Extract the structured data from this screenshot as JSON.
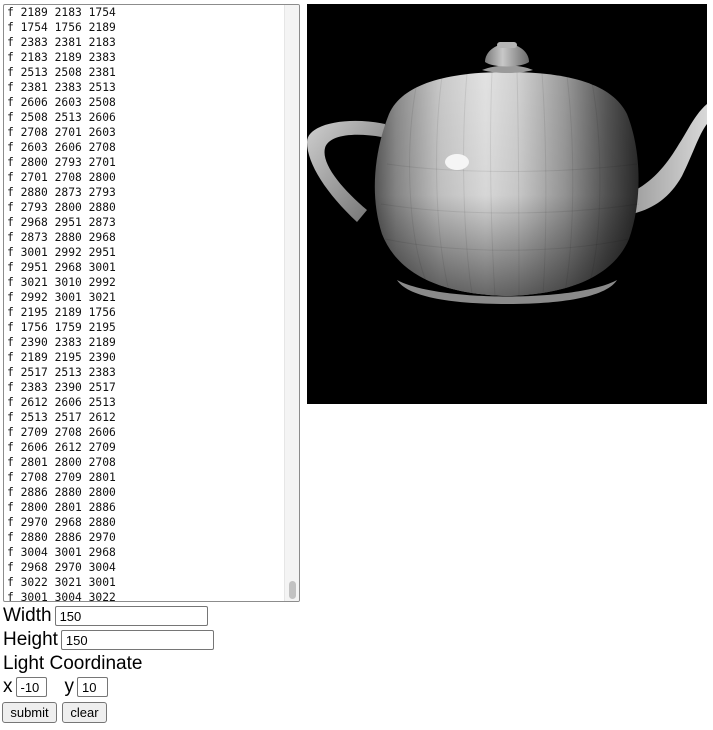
{
  "obj_text_lines": [
    "f 2189 2183 1754",
    "f 1754 1756 2189",
    "f 2383 2381 2183",
    "f 2183 2189 2383",
    "f 2513 2508 2381",
    "f 2381 2383 2513",
    "f 2606 2603 2508",
    "f 2508 2513 2606",
    "f 2708 2701 2603",
    "f 2603 2606 2708",
    "f 2800 2793 2701",
    "f 2701 2708 2800",
    "f 2880 2873 2793",
    "f 2793 2800 2880",
    "f 2968 2951 2873",
    "f 2873 2880 2968",
    "f 3001 2992 2951",
    "f 2951 2968 3001",
    "f 3021 3010 2992",
    "f 2992 3001 3021",
    "f 2195 2189 1756",
    "f 1756 1759 2195",
    "f 2390 2383 2189",
    "f 2189 2195 2390",
    "f 2517 2513 2383",
    "f 2383 2390 2517",
    "f 2612 2606 2513",
    "f 2513 2517 2612",
    "f 2709 2708 2606",
    "f 2606 2612 2709",
    "f 2801 2800 2708",
    "f 2708 2709 2801",
    "f 2886 2880 2800",
    "f 2800 2801 2886",
    "f 2970 2968 2880",
    "f 2880 2886 2970",
    "f 3004 3001 2968",
    "f 2968 2970 3004",
    "f 3022 3021 3001",
    "f 3001 3004 3022"
  ],
  "form": {
    "width_label": "Width",
    "width_value": "150",
    "height_label": "Height",
    "height_value": "150",
    "light_heading": "Light Coordinate",
    "x_label": "x",
    "x_value": "-10",
    "y_label": "y",
    "y_value": "10",
    "submit_label": "submit",
    "clear_label": "clear"
  },
  "render": {
    "background": "#000000",
    "subject": "teapot"
  }
}
